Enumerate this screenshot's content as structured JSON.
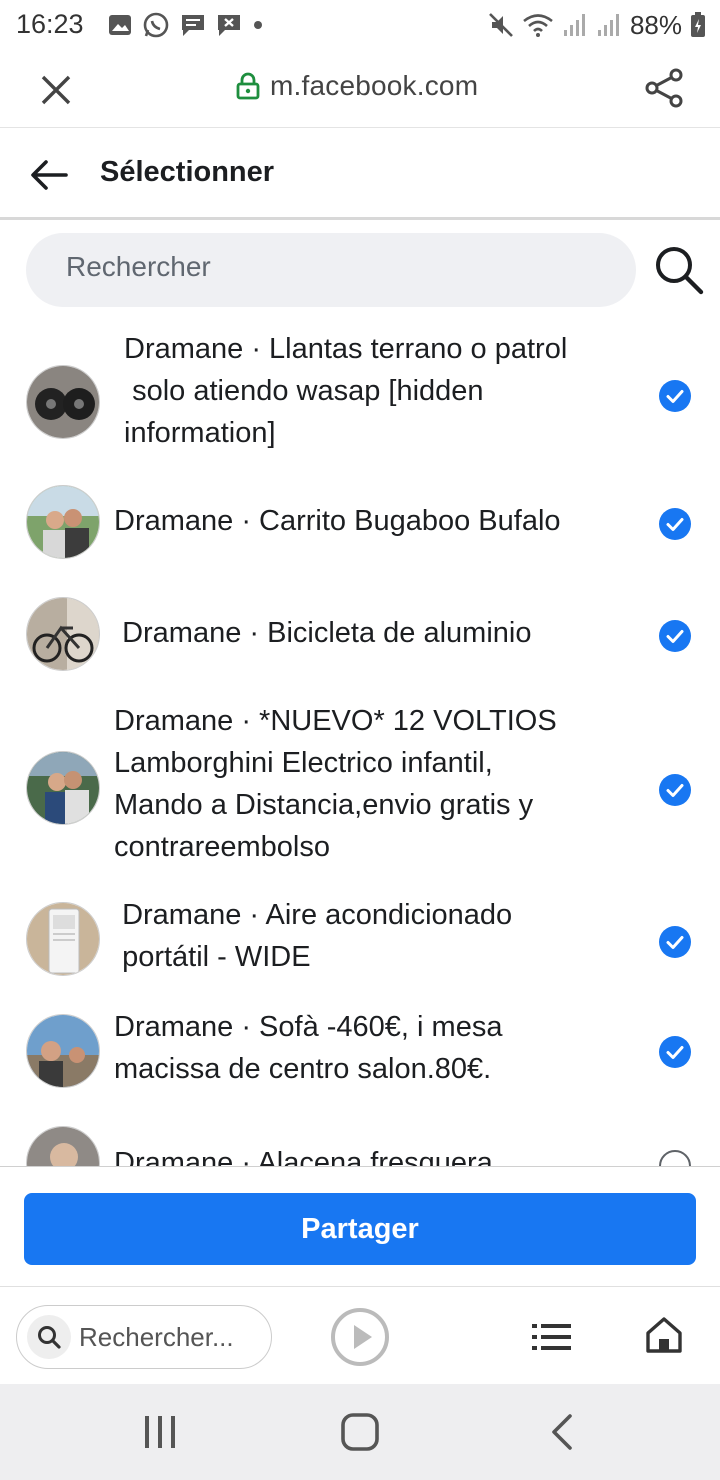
{
  "status": {
    "time": "16:23",
    "battery": "88%"
  },
  "browser": {
    "url": "m.facebook.com"
  },
  "header": {
    "title": "Sélectionner"
  },
  "search": {
    "placeholder": "Rechercher"
  },
  "items": [
    {
      "text": "Dramane · Llantas terrano o patrol\n solo atiendo wasap [hidden\ninformation]",
      "checked": true
    },
    {
      "text": "Dramane · Carrito Bugaboo Bufalo",
      "checked": true
    },
    {
      "text": " Dramane · Bicicleta de aluminio",
      "checked": true
    },
    {
      "text": "Dramane · *NUEVO* 12 VOLTIOS\nLamborghini Electrico infantil,\nMando a Distancia,envio gratis y\ncontrareembolso",
      "checked": true
    },
    {
      "text": " Dramane · Aire acondicionado\n portátil - WIDE",
      "checked": true
    },
    {
      "text": "Dramane · Sofà -460€, i mesa\nmacissa de centro salon.80€.",
      "checked": true
    },
    {
      "text": "Dramane · Alacena fresquera",
      "checked": false
    }
  ],
  "footer": {
    "share_label": "Partager"
  },
  "bottombar": {
    "search_placeholder": "Rechercher..."
  },
  "colors": {
    "accent": "#1877f2",
    "search_bg": "#eff0f3"
  },
  "icons": [
    "close-icon",
    "lock-icon",
    "share-icon",
    "back-arrow-icon",
    "search-icon",
    "check-icon",
    "play-icon",
    "menu-icon",
    "home-icon"
  ]
}
